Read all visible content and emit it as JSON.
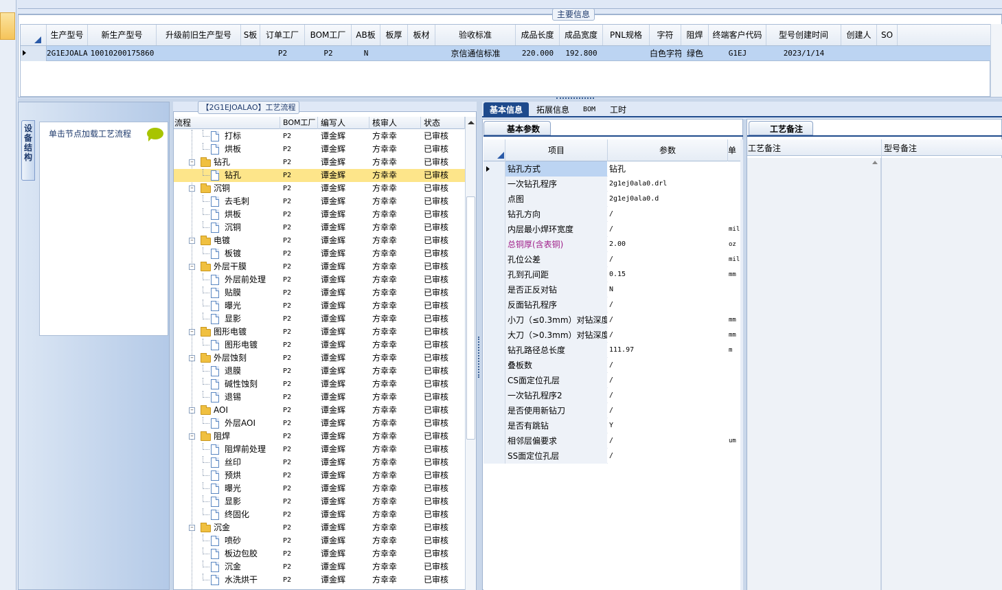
{
  "main_info": {
    "group_title": "主要信息",
    "columns": [
      "生产型号",
      "新生产型号",
      "升级前旧生产型号",
      "S板",
      "订单工厂",
      "BOM工厂",
      "AB板",
      "板厚",
      "板材",
      "验收标准",
      "成品长度",
      "成品宽度",
      "PNL规格",
      "字符",
      "阻焊",
      "终端客户代码",
      "型号创建时间",
      "创建人",
      "SO"
    ],
    "row": [
      "2G1EJOALAO",
      "10010200175860",
      "",
      "",
      "P2",
      "P2",
      "N",
      "",
      "",
      "京信通信标准",
      "220.000",
      "192.800",
      "",
      "白色字符",
      "绿色",
      "G1EJ",
      "2023/1/14",
      "",
      ""
    ]
  },
  "left_panel": {
    "vertical_tab": "设备结构",
    "hint_text": "单击节点加载工艺流程"
  },
  "process_flow": {
    "title": "【2G1EJOALAO】工艺流程",
    "columns": [
      "流程",
      "BOM工厂",
      "编写人",
      "核审人",
      "状态"
    ],
    "rows": [
      {
        "level": 2,
        "name": "打标",
        "bom": "P2",
        "writer": "谭金辉",
        "reviewer": "方幸幸",
        "status": "已审核"
      },
      {
        "level": 2,
        "name": "烘板",
        "bom": "P2",
        "writer": "谭金辉",
        "reviewer": "方幸幸",
        "status": "已审核"
      },
      {
        "level": 1,
        "name": "钻孔",
        "bom": "P2",
        "writer": "谭金辉",
        "reviewer": "方幸幸",
        "status": "已审核"
      },
      {
        "level": 2,
        "name": "钻孔",
        "bom": "P2",
        "writer": "谭金辉",
        "reviewer": "方幸幸",
        "status": "已审核",
        "selected": true
      },
      {
        "level": 1,
        "name": "沉铜",
        "bom": "P2",
        "writer": "谭金辉",
        "reviewer": "方幸幸",
        "status": "已审核"
      },
      {
        "level": 2,
        "name": "去毛刺",
        "bom": "P2",
        "writer": "谭金辉",
        "reviewer": "方幸幸",
        "status": "已审核"
      },
      {
        "level": 2,
        "name": "烘板",
        "bom": "P2",
        "writer": "谭金辉",
        "reviewer": "方幸幸",
        "status": "已审核"
      },
      {
        "level": 2,
        "name": "沉铜",
        "bom": "P2",
        "writer": "谭金辉",
        "reviewer": "方幸幸",
        "status": "已审核"
      },
      {
        "level": 1,
        "name": "电镀",
        "bom": "P2",
        "writer": "谭金辉",
        "reviewer": "方幸幸",
        "status": "已审核"
      },
      {
        "level": 2,
        "name": "板镀",
        "bom": "P2",
        "writer": "谭金辉",
        "reviewer": "方幸幸",
        "status": "已审核"
      },
      {
        "level": 1,
        "name": "外层干膜",
        "bom": "P2",
        "writer": "谭金辉",
        "reviewer": "方幸幸",
        "status": "已审核"
      },
      {
        "level": 2,
        "name": "外层前处理",
        "bom": "P2",
        "writer": "谭金辉",
        "reviewer": "方幸幸",
        "status": "已审核"
      },
      {
        "level": 2,
        "name": "贴膜",
        "bom": "P2",
        "writer": "谭金辉",
        "reviewer": "方幸幸",
        "status": "已审核"
      },
      {
        "level": 2,
        "name": "曝光",
        "bom": "P2",
        "writer": "谭金辉",
        "reviewer": "方幸幸",
        "status": "已审核"
      },
      {
        "level": 2,
        "name": "显影",
        "bom": "P2",
        "writer": "谭金辉",
        "reviewer": "方幸幸",
        "status": "已审核"
      },
      {
        "level": 1,
        "name": "图形电镀",
        "bom": "P2",
        "writer": "谭金辉",
        "reviewer": "方幸幸",
        "status": "已审核"
      },
      {
        "level": 2,
        "name": "图形电镀",
        "bom": "P2",
        "writer": "谭金辉",
        "reviewer": "方幸幸",
        "status": "已审核"
      },
      {
        "level": 1,
        "name": "外层蚀刻",
        "bom": "P2",
        "writer": "谭金辉",
        "reviewer": "方幸幸",
        "status": "已审核"
      },
      {
        "level": 2,
        "name": "退膜",
        "bom": "P2",
        "writer": "谭金辉",
        "reviewer": "方幸幸",
        "status": "已审核"
      },
      {
        "level": 2,
        "name": "碱性蚀刻",
        "bom": "P2",
        "writer": "谭金辉",
        "reviewer": "方幸幸",
        "status": "已审核"
      },
      {
        "level": 2,
        "name": "退锡",
        "bom": "P2",
        "writer": "谭金辉",
        "reviewer": "方幸幸",
        "status": "已审核"
      },
      {
        "level": 1,
        "name": "AOI",
        "bom": "P2",
        "writer": "谭金辉",
        "reviewer": "方幸幸",
        "status": "已审核"
      },
      {
        "level": 2,
        "name": "外层AOI",
        "bom": "P2",
        "writer": "谭金辉",
        "reviewer": "方幸幸",
        "status": "已审核"
      },
      {
        "level": 1,
        "name": "阻焊",
        "bom": "P2",
        "writer": "谭金辉",
        "reviewer": "方幸幸",
        "status": "已审核"
      },
      {
        "level": 2,
        "name": "阻焊前处理",
        "bom": "P2",
        "writer": "谭金辉",
        "reviewer": "方幸幸",
        "status": "已审核"
      },
      {
        "level": 2,
        "name": "丝印",
        "bom": "P2",
        "writer": "谭金辉",
        "reviewer": "方幸幸",
        "status": "已审核"
      },
      {
        "level": 2,
        "name": "预烘",
        "bom": "P2",
        "writer": "谭金辉",
        "reviewer": "方幸幸",
        "status": "已审核"
      },
      {
        "level": 2,
        "name": "曝光",
        "bom": "P2",
        "writer": "谭金辉",
        "reviewer": "方幸幸",
        "status": "已审核"
      },
      {
        "level": 2,
        "name": "显影",
        "bom": "P2",
        "writer": "谭金辉",
        "reviewer": "方幸幸",
        "status": "已审核"
      },
      {
        "level": 2,
        "name": "终固化",
        "bom": "P2",
        "writer": "谭金辉",
        "reviewer": "方幸幸",
        "status": "已审核"
      },
      {
        "level": 1,
        "name": "沉金",
        "bom": "P2",
        "writer": "谭金辉",
        "reviewer": "方幸幸",
        "status": "已审核"
      },
      {
        "level": 2,
        "name": "喷砂",
        "bom": "P2",
        "writer": "谭金辉",
        "reviewer": "方幸幸",
        "status": "已审核"
      },
      {
        "level": 2,
        "name": "板边包胶",
        "bom": "P2",
        "writer": "谭金辉",
        "reviewer": "方幸幸",
        "status": "已审核"
      },
      {
        "level": 2,
        "name": "沉金",
        "bom": "P2",
        "writer": "谭金辉",
        "reviewer": "方幸幸",
        "status": "已审核"
      },
      {
        "level": 2,
        "name": "水洗烘干",
        "bom": "P2",
        "writer": "谭金辉",
        "reviewer": "方幸幸",
        "status": "已审核"
      }
    ]
  },
  "detail_tabs": [
    "基本信息",
    "拓展信息",
    "BOM",
    "工时"
  ],
  "basic_params": {
    "subtab": "基本参数",
    "columns": [
      "项目",
      "参数",
      "单"
    ],
    "rows": [
      {
        "name": "钻孔方式",
        "value": "钻孔",
        "unit": ""
      },
      {
        "name": "一次钻孔程序",
        "value": "2g1ej0ala0.drl",
        "unit": ""
      },
      {
        "name": "点图",
        "value": "2g1ej0ala0.d",
        "unit": ""
      },
      {
        "name": "钻孔方向",
        "value": "/",
        "unit": ""
      },
      {
        "name": "内层最小焊环宽度",
        "value": "/",
        "unit": "mil"
      },
      {
        "name": "总铜厚(含表铜)",
        "value": "2.00",
        "unit": "oz",
        "highlight": true
      },
      {
        "name": "孔位公差",
        "value": "/",
        "unit": "mil"
      },
      {
        "name": "孔到孔间距",
        "value": "0.15",
        "unit": "mm"
      },
      {
        "name": "是否正反对钻",
        "value": "N",
        "unit": ""
      },
      {
        "name": "反面钻孔程序",
        "value": "/",
        "unit": ""
      },
      {
        "name": "小刀（≤0.3mm）对钻深度",
        "value": "/",
        "unit": "mm"
      },
      {
        "name": "大刀（>0.3mm）对钻深度",
        "value": "/",
        "unit": "mm"
      },
      {
        "name": "钻孔路径总长度",
        "value": "111.97",
        "unit": "m"
      },
      {
        "name": "叠板数",
        "value": "/",
        "unit": ""
      },
      {
        "name": "CS面定位孔层",
        "value": "/",
        "unit": ""
      },
      {
        "name": "一次钻孔程序2",
        "value": "/",
        "unit": ""
      },
      {
        "name": "是否使用新钻刀",
        "value": "/",
        "unit": ""
      },
      {
        "name": "是否有跳钻",
        "value": "Y",
        "unit": ""
      },
      {
        "name": "相邻层偏要求",
        "value": "/",
        "unit": "um"
      },
      {
        "name": "SS面定位孔层",
        "value": "/",
        "unit": ""
      }
    ]
  },
  "remarks": {
    "subtab": "工艺备注",
    "col1": "工艺备注",
    "col2": "型号备注"
  },
  "colors": {
    "accent": "#1e4a8c",
    "selected_row": "#fde58a",
    "main_row": "#bcd4f2",
    "highlight_text": "#a0208a"
  }
}
